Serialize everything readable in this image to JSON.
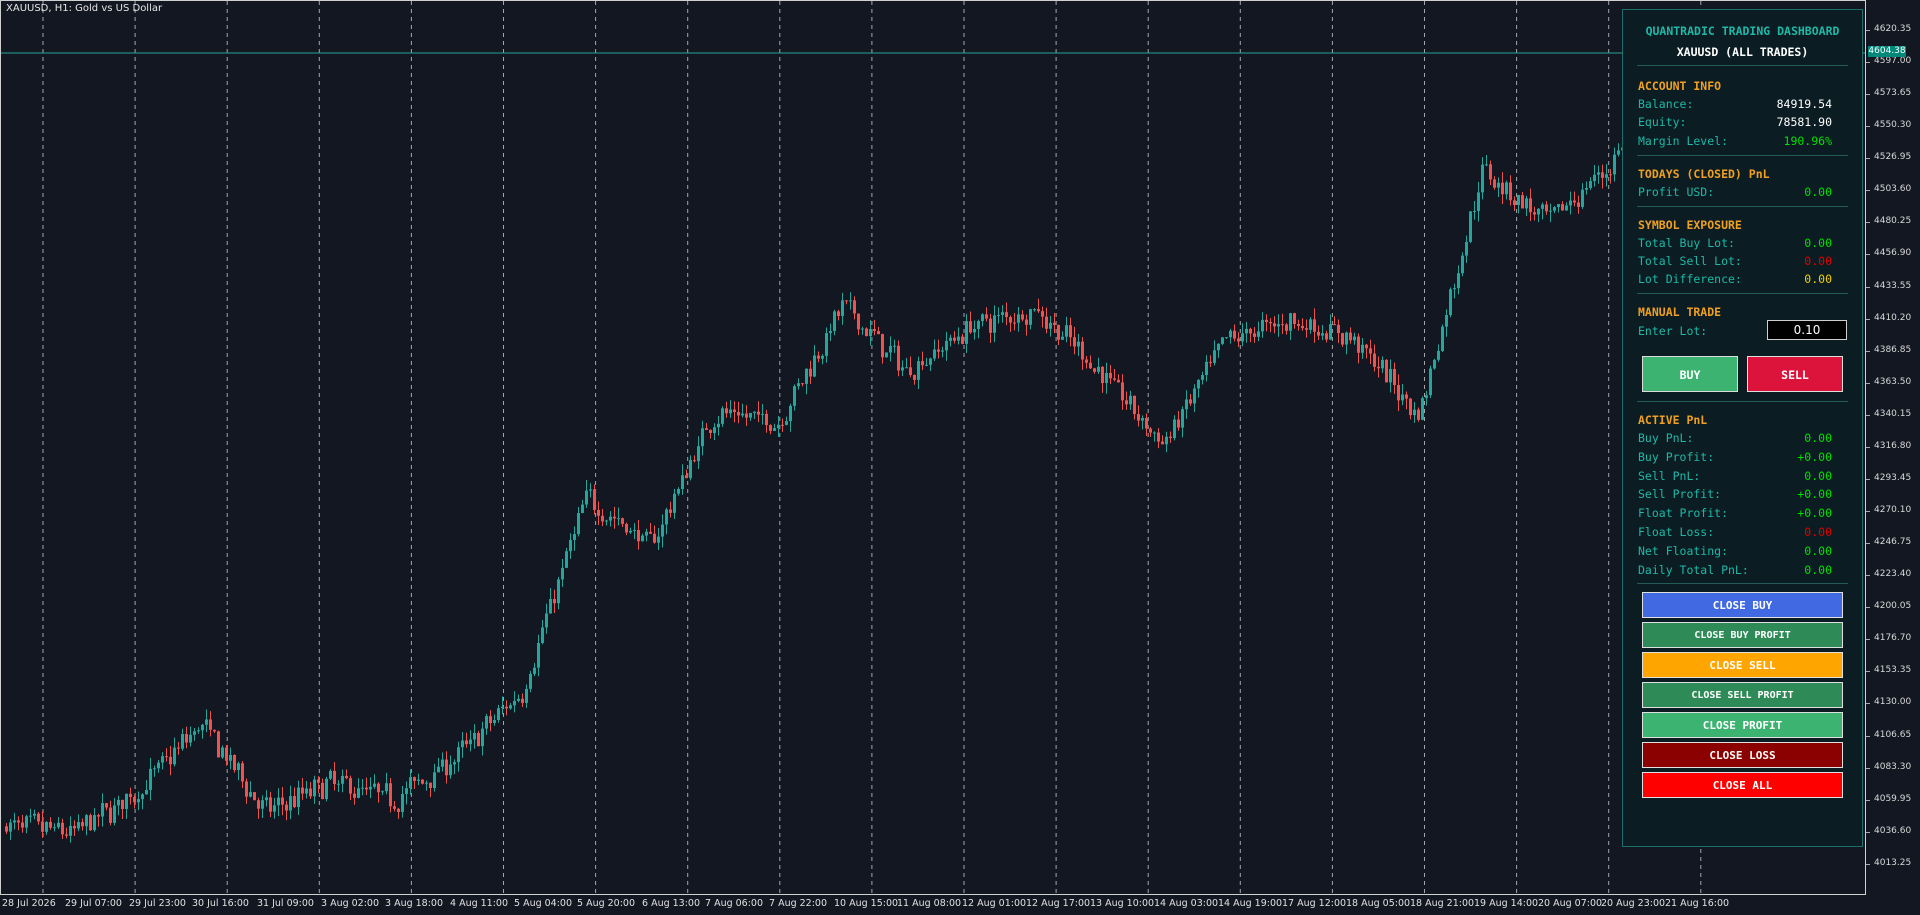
{
  "chart": {
    "title": "XAUUSD, H1:  Gold vs US Dollar",
    "current_price": "4604.38",
    "price_ticks": [
      "4620.35",
      "4597.00",
      "4573.65",
      "4550.30",
      "4526.95",
      "4503.60",
      "4480.25",
      "4456.90",
      "4433.55",
      "4410.20",
      "4386.85",
      "4363.50",
      "4340.15",
      "4316.80",
      "4293.45",
      "4270.10",
      "4246.75",
      "4223.40",
      "4200.05",
      "4176.70",
      "4153.35",
      "4130.00",
      "4106.65",
      "4083.30",
      "4059.95",
      "4036.60",
      "4013.25"
    ],
    "time_ticks": [
      "28 Jul 2026",
      "29 Jul 07:00",
      "29 Jul 23:00",
      "30 Jul 16:00",
      "31 Jul 09:00",
      "3 Aug 02:00",
      "3 Aug 18:00",
      "4 Aug 11:00",
      "5 Aug 04:00",
      "5 Aug 20:00",
      "6 Aug 13:00",
      "7 Aug 06:00",
      "7 Aug 22:00",
      "10 Aug 15:00",
      "11 Aug 08:00",
      "12 Aug 01:00",
      "12 Aug 17:00",
      "13 Aug 10:00",
      "14 Aug 03:00",
      "14 Aug 19:00",
      "17 Aug 12:00",
      "18 Aug 05:00",
      "18 Aug 21:00",
      "19 Aug 14:00",
      "20 Aug 07:00",
      "20 Aug 23:00",
      "21 Aug 16:00"
    ],
    "colors": {
      "bull": "#26a69a",
      "bear": "#ef5350",
      "grid": "#c8c8c8",
      "price_line": "#26a69a"
    }
  },
  "chart_data": {
    "type": "candlestick",
    "symbol": "XAUUSD",
    "timeframe": "H1",
    "ylim": [
      4005,
      4632
    ],
    "close_path": [
      [
        "28 Jul 2026",
        4040
      ],
      [
        "29 Jul 07:00",
        4035
      ],
      [
        "29 Jul 23:00",
        4065
      ],
      [
        "30 Jul 16:00",
        4115
      ],
      [
        "31 Jul 09:00",
        4050
      ],
      [
        "3 Aug 02:00",
        4072
      ],
      [
        "3 Aug 18:00",
        4060
      ],
      [
        "4 Aug 11:00",
        4092
      ],
      [
        "5 Aug 04:00",
        4140
      ],
      [
        "5 Aug 20:00",
        4280
      ],
      [
        "6 Aug 13:00",
        4245
      ],
      [
        "7 Aug 06:00",
        4342
      ],
      [
        "7 Aug 22:00",
        4335
      ],
      [
        "10 Aug 15:00",
        4420
      ],
      [
        "11 Aug 08:00",
        4372
      ],
      [
        "12 Aug 01:00",
        4405
      ],
      [
        "12 Aug 17:00",
        4418
      ],
      [
        "13 Aug 10:00",
        4373
      ],
      [
        "14 Aug 03:00",
        4318
      ],
      [
        "14 Aug 19:00",
        4395
      ],
      [
        "17 Aug 12:00",
        4410
      ],
      [
        "18 Aug 05:00",
        4395
      ],
      [
        "18 Aug 21:00",
        4340
      ],
      [
        "19 Aug 14:00",
        4520
      ],
      [
        "20 Aug 07:00",
        4480
      ],
      [
        "20 Aug 23:00",
        4522
      ]
    ]
  },
  "dashboard": {
    "title": "QUANTRADIC TRADING DASHBOARD",
    "subtitle": "XAUUSD (ALL TRADES)",
    "account": {
      "header": "ACCOUNT INFO",
      "balance_label": "Balance:",
      "balance": "84919.54",
      "equity_label": "Equity:",
      "equity": "78581.90",
      "margin_label": "Margin Level:",
      "margin": "190.96%"
    },
    "today": {
      "header": "TODAYS (CLOSED) PnL",
      "profit_label": "Profit USD:",
      "profit": "0.00"
    },
    "exposure": {
      "header": "SYMBOL EXPOSURE",
      "buy_label": "Total Buy Lot:",
      "buy": "0.00",
      "sell_label": "Total Sell Lot:",
      "sell": "0.00",
      "diff_label": "Lot Difference:",
      "diff": "0.00"
    },
    "manual": {
      "header": "MANUAL TRADE",
      "lot_label": "Enter Lot:",
      "lot_value": "0.10",
      "buy_label": "BUY",
      "sell_label": "SELL"
    },
    "active": {
      "header": "ACTIVE PnL",
      "rows": [
        {
          "label": "Buy PnL:",
          "value": "0.00",
          "color": "#00e000"
        },
        {
          "label": "Buy Profit:",
          "value": "+0.00",
          "color": "#00e000"
        },
        {
          "label": "Sell PnL:",
          "value": "0.00",
          "color": "#00e000"
        },
        {
          "label": "Sell Profit:",
          "value": "+0.00",
          "color": "#00e000"
        },
        {
          "label": "Float Profit:",
          "value": "+0.00",
          "color": "#00e000"
        },
        {
          "label": "Float Loss:",
          "value": "0.00",
          "color": "#e00000"
        },
        {
          "label": "Net Floating:",
          "value": "0.00",
          "color": "#00e000"
        },
        {
          "label": "Daily Total PnL:",
          "value": "0.00",
          "color": "#00e000"
        }
      ]
    },
    "buttons": {
      "close_buy": "CLOSE BUY",
      "close_buy_profit": "CLOSE BUY PROFIT",
      "close_sell": "CLOSE SELL",
      "close_sell_profit": "CLOSE SELL PROFIT",
      "close_profit": "CLOSE PROFIT",
      "close_loss": "CLOSE LOSS",
      "close_all": "CLOSE ALL"
    },
    "colors": {
      "title": "#1fb8a8",
      "section": "#f0a020",
      "label": "#1fb8a8",
      "green": "#00e000",
      "red": "#e00000",
      "yellow": "#f0d000",
      "close_buy": "#4169e1",
      "close_buy_profit": "#2e8b57",
      "close_sell": "#ffa500",
      "close_sell_profit": "#2e8b57",
      "close_profit": "#3cb371",
      "close_loss": "#8b0000",
      "close_all": "#ff0000"
    }
  }
}
